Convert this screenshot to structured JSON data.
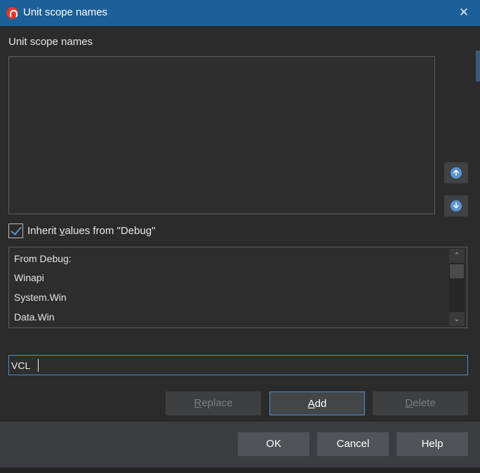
{
  "window": {
    "title": "Unit scope names",
    "app_icon": "delphi-helmet-icon",
    "close_glyph": "✕"
  },
  "scope_section": {
    "label": "Unit scope names",
    "items": [],
    "move_up_icon": "arrow-up-icon",
    "move_down_icon": "arrow-down-icon"
  },
  "inherit": {
    "checked": true,
    "label_prefix": "Inherit ",
    "label_accel": "v",
    "label_suffix": "alues from \"Debug\"",
    "items": [
      "From Debug:",
      "Winapi",
      "System.Win",
      "Data.Win"
    ]
  },
  "entry": {
    "value": "VCL"
  },
  "actions": {
    "replace_accel": "R",
    "replace_rest": "eplace",
    "add_accel": "A",
    "add_rest": "dd",
    "delete_accel": "D",
    "delete_rest": "elete"
  },
  "footer": {
    "ok": "OK",
    "cancel": "Cancel",
    "help": "Help"
  },
  "colors": {
    "titlebar": "#1d5f99",
    "accent": "#4e8ccf",
    "background": "#2b2b2b"
  }
}
